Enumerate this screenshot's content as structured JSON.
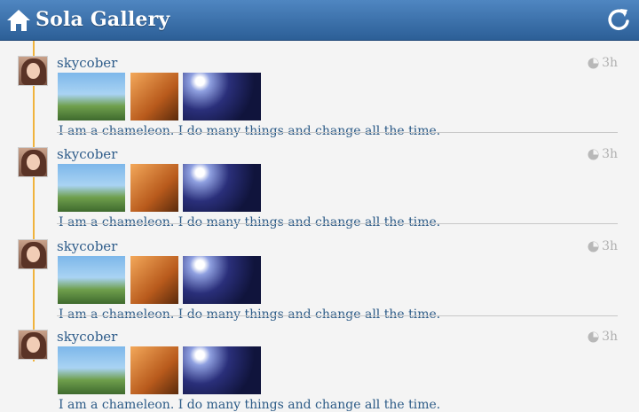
{
  "app": {
    "title": "Sola Gallery",
    "accent": "#2c5f97",
    "timeline_color": "#f0b33c"
  },
  "header": {
    "home_icon": "home-icon",
    "refresh_icon": "refresh-icon"
  },
  "posts": [
    {
      "username": "skycober",
      "time": "3h",
      "caption": "I am a chameleon. I do many things and change all the time."
    },
    {
      "username": "skycober",
      "time": "3h",
      "caption": "I am a chameleon. I do many things and change all the time."
    },
    {
      "username": "skycober",
      "time": "3h",
      "caption": "I am a chameleon. I do many things and change all the time."
    },
    {
      "username": "skycober",
      "time": "3h",
      "caption": "I am a chameleon. I do many things and change all the time."
    }
  ]
}
